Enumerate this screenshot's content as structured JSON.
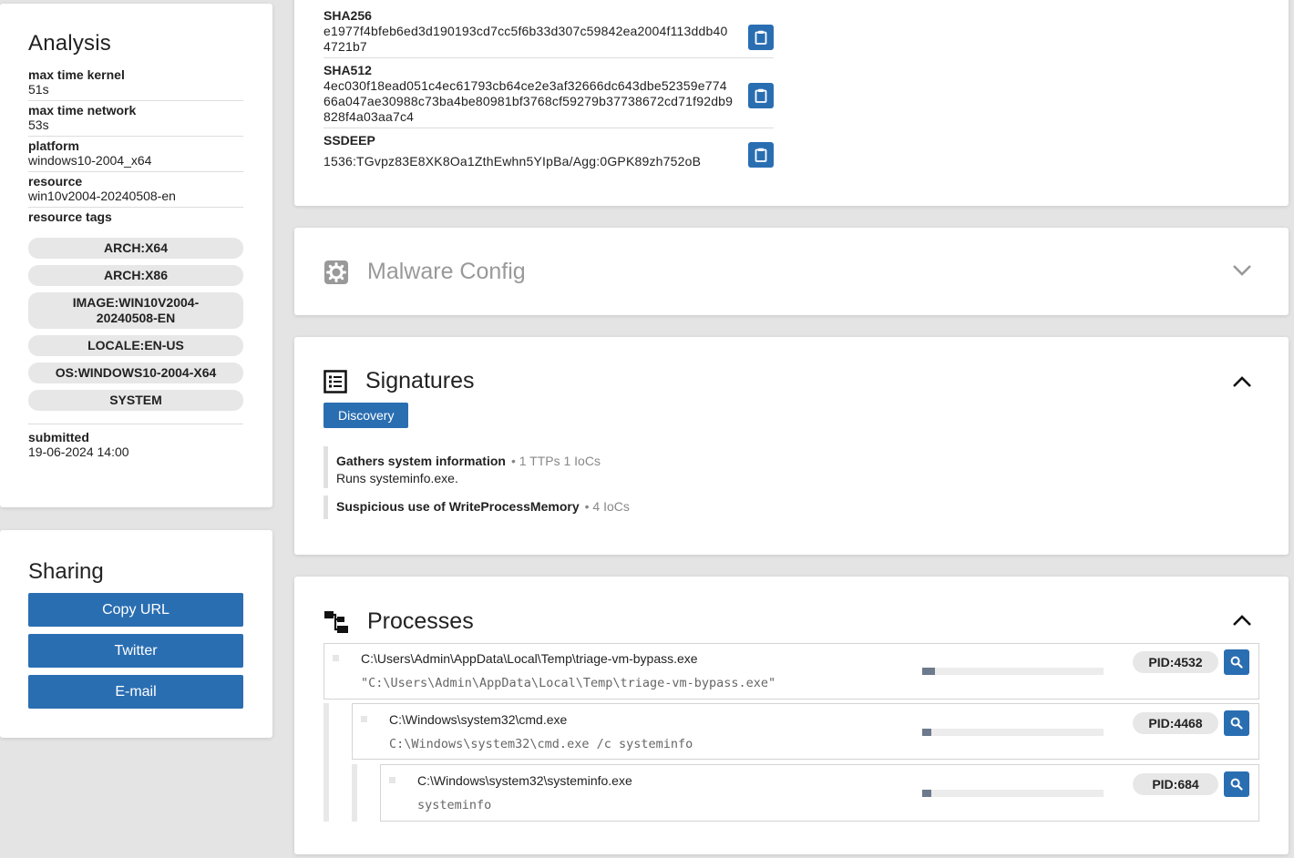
{
  "analysis": {
    "title": "Analysis",
    "fields": [
      {
        "label": "max time kernel",
        "value": "51s"
      },
      {
        "label": "max time network",
        "value": "53s"
      },
      {
        "label": "platform",
        "value": "windows10-2004_x64"
      },
      {
        "label": "resource",
        "value": "win10v2004-20240508-en"
      }
    ],
    "resource_tags_label": "resource tags",
    "resource_tags": [
      "ARCH:X64",
      "ARCH:X86",
      "IMAGE:WIN10V2004-20240508-EN",
      "LOCALE:EN-US",
      "OS:WINDOWS10-2004-X64",
      "SYSTEM"
    ],
    "submitted_label": "submitted",
    "submitted_value": "19-06-2024 14:00"
  },
  "sharing": {
    "title": "Sharing",
    "buttons": [
      "Copy URL",
      "Twitter",
      "E-mail"
    ]
  },
  "hashes": [
    {
      "label": "SHA256",
      "value": "e1977f4bfeb6ed3d190193cd7cc5f6b33d307c59842ea2004f113ddb404721b7"
    },
    {
      "label": "SHA512",
      "value": "4ec030f18ead051c4ec61793cb64ce2e3af32666dc643dbe52359e77466a047ae30988c73ba4be80981bf3768cf59279b37738672cd71f92db9828f4a03aa7c4"
    },
    {
      "label": "SSDEEP",
      "value": "1536:TGvpz83E8XK8Oa1ZthEwhn5YIpBa/Agg:0GPK89zh752oB"
    }
  ],
  "malware_config": {
    "title": "Malware Config"
  },
  "signatures": {
    "title": "Signatures",
    "tag": "Discovery",
    "items": [
      {
        "name": "Gathers system information",
        "meta": "1 TTPs 1 IoCs",
        "desc": "Runs systeminfo.exe."
      },
      {
        "name": "Suspicious use of WriteProcessMemory",
        "meta": "4 IoCs",
        "desc": ""
      }
    ]
  },
  "processes": {
    "title": "Processes",
    "items": [
      {
        "path": "C:\\Users\\Admin\\AppData\\Local\\Temp\\triage-vm-bypass.exe",
        "cmd": "\"C:\\Users\\Admin\\AppData\\Local\\Temp\\triage-vm-bypass.exe\"",
        "pid": "PID:4532",
        "progress": 0.07
      },
      {
        "path": "C:\\Windows\\system32\\cmd.exe",
        "cmd": "C:\\Windows\\system32\\cmd.exe /c systeminfo",
        "pid": "PID:4468",
        "progress": 0.05
      },
      {
        "path": "C:\\Windows\\system32\\systeminfo.exe",
        "cmd": "systeminfo",
        "pid": "PID:684",
        "progress": 0.05
      }
    ]
  },
  "colors": {
    "accent": "#2a6eb2",
    "bar_fill": "#6c7a8c"
  }
}
